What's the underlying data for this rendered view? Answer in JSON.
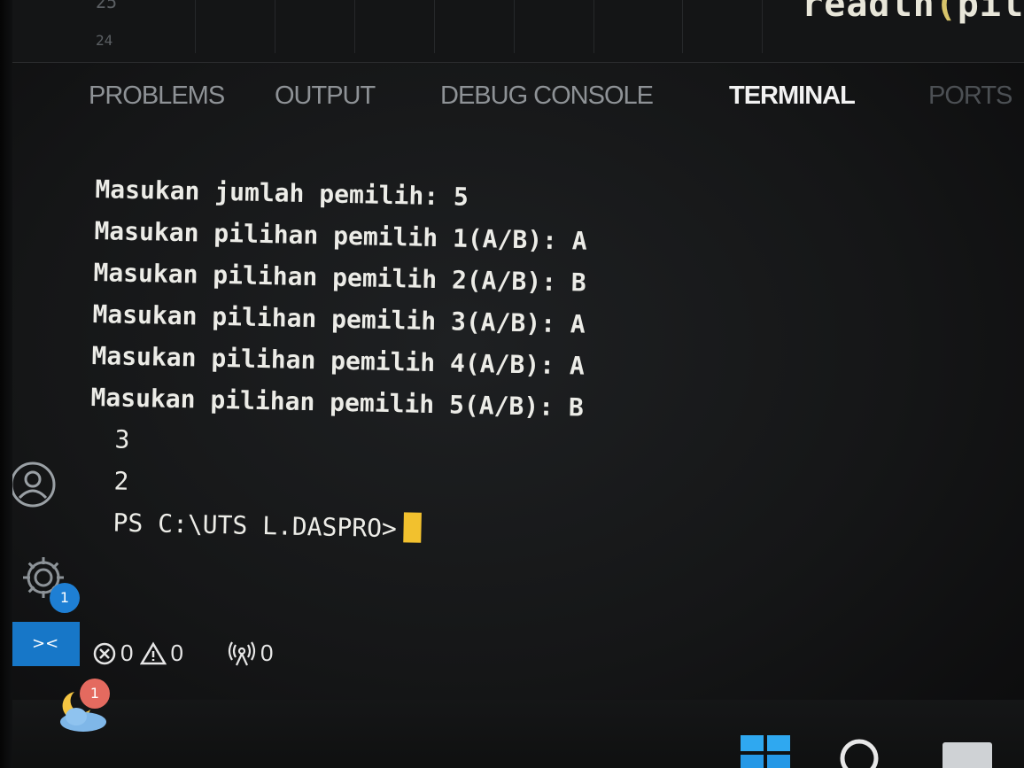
{
  "editor": {
    "line_numbers": [
      "25",
      "24"
    ],
    "code_fragment": "readln(pil",
    "code_paren": "("
  },
  "panel": {
    "tabs": [
      {
        "label": "PROBLEMS",
        "active": false
      },
      {
        "label": "OUTPUT",
        "active": false
      },
      {
        "label": "DEBUG CONSOLE",
        "active": false
      },
      {
        "label": "TERMINAL",
        "active": true
      },
      {
        "label": "PORTS",
        "active": false
      }
    ]
  },
  "terminal": {
    "lines": [
      "Masukan jumlah pemilih: 5",
      "Masukan pilihan pemilih 1(A/B): A",
      "Masukan pilihan pemilih 2(A/B): B",
      "Masukan pilihan pemilih 3(A/B): A",
      "Masukan pilihan pemilih 4(A/B): A",
      "Masukan pilihan pemilih 5(A/B): B",
      "3",
      "2"
    ],
    "prompt": "PS C:\\UTS L.DASPRO>",
    "cursor_color": "#f2c12e"
  },
  "activity_bar": {
    "settings_badge": "1"
  },
  "status_bar": {
    "remote_color": "#1777c8",
    "errors": "0",
    "warnings": "0",
    "ports": "0"
  },
  "taskbar": {
    "weather_badge": "1"
  },
  "icons": {
    "account": "account-icon",
    "settings": "gear-icon",
    "remote": "remote-icon",
    "errors": "error-circle-icon",
    "warnings": "warning-triangle-icon",
    "ports": "broadcast-icon",
    "weather": "weather-icon",
    "start": "windows-start-icon",
    "search": "search-icon"
  }
}
